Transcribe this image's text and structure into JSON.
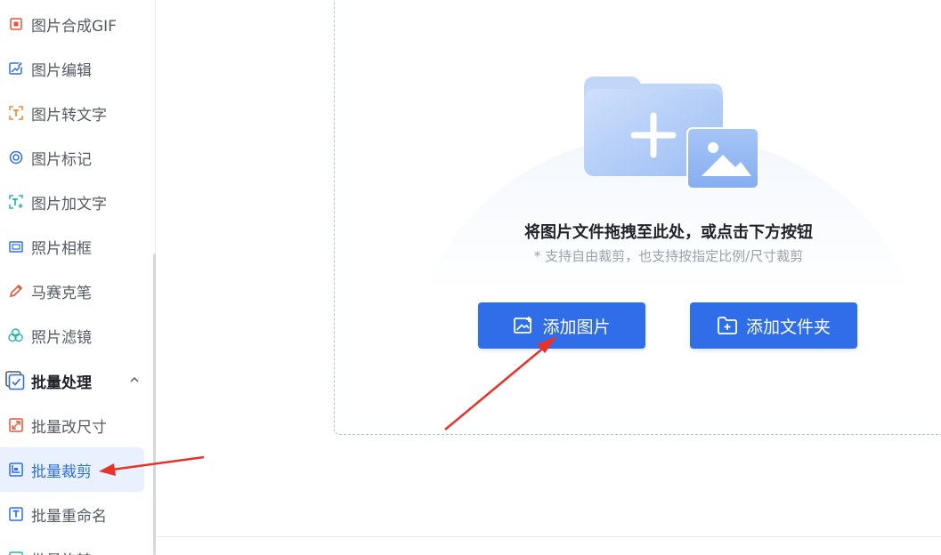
{
  "sidebar": {
    "items": [
      {
        "label": "图片合成GIF",
        "icon": "gif-merge-icon",
        "color": "#e8533a"
      },
      {
        "label": "图片编辑",
        "icon": "image-edit-icon",
        "color": "#2f6ee8"
      },
      {
        "label": "图片转文字",
        "icon": "image-to-text-icon",
        "color": "#f08a3c"
      },
      {
        "label": "图片标记",
        "icon": "image-mark-icon",
        "color": "#2f6ee8"
      },
      {
        "label": "图片加文字",
        "icon": "add-text-icon",
        "color": "#25b7a8"
      },
      {
        "label": "照片相框",
        "icon": "photo-frame-icon",
        "color": "#2f6ee8"
      },
      {
        "label": "马赛克笔",
        "icon": "mosaic-pen-icon",
        "color": "#e8533a"
      },
      {
        "label": "照片滤镜",
        "icon": "photo-filter-icon",
        "color": "#25b7a8"
      }
    ],
    "group": {
      "label": "批量处理",
      "icon": "batch-process-icon",
      "expanded": true
    },
    "sub_items": [
      {
        "label": "批量改尺寸",
        "icon": "batch-resize-icon",
        "color": "#e8533a",
        "active": false
      },
      {
        "label": "批量裁剪",
        "icon": "batch-crop-icon",
        "color": "#2f6ee8",
        "active": true
      },
      {
        "label": "批量重命名",
        "icon": "batch-rename-icon",
        "color": "#2f6ee8",
        "active": false
      },
      {
        "label": "批量旋转",
        "icon": "batch-rotate-icon",
        "color": "#25b7a8",
        "active": false
      }
    ]
  },
  "dropzone": {
    "title": "将图片文件拖拽至此处，或点击下方按钮",
    "subtitle": "* 支持自由裁剪，也支持按指定比例/尺寸裁剪",
    "illustration": "folder-with-image-icon"
  },
  "buttons": {
    "add_image": "添加图片",
    "add_folder": "添加文件夹"
  },
  "colors": {
    "primary": "#2f6ee8",
    "active_bg": "#e9f0fe",
    "annotation_arrow": "#e8332a"
  }
}
